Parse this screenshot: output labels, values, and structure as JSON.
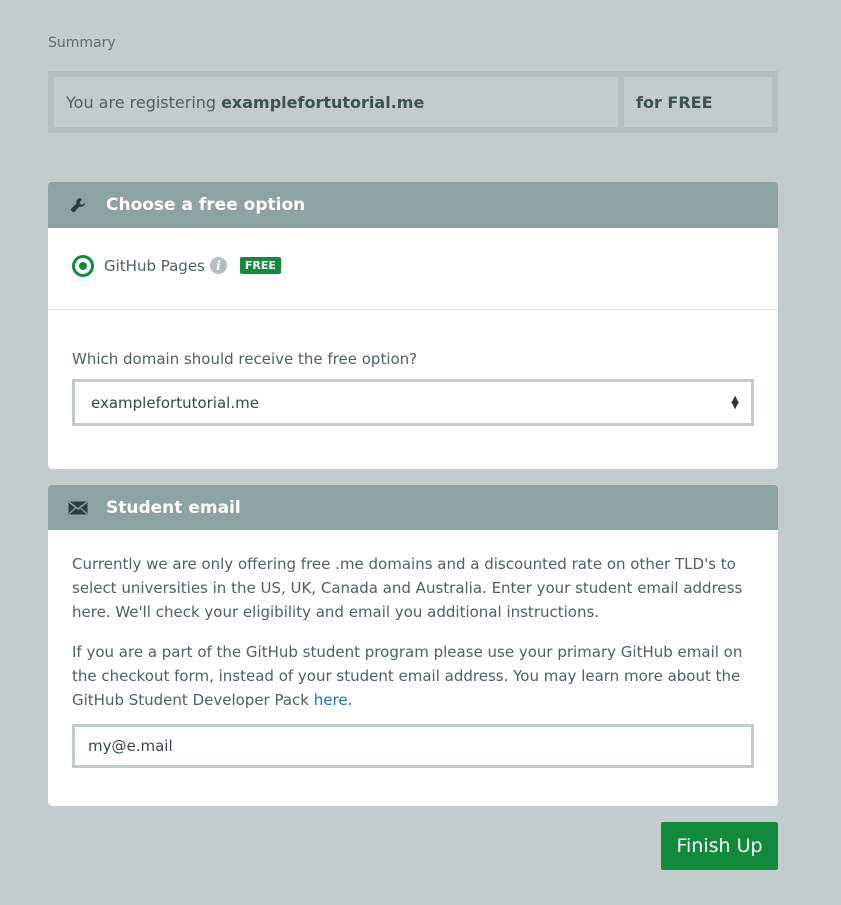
{
  "summary": {
    "label": "Summary",
    "registering_prefix": "You are registering",
    "domain": "examplefortutorial.me",
    "price": "for FREE"
  },
  "free_option": {
    "title": "Choose a free option",
    "icon": "wrench-icon",
    "option_label": "GitHub Pages",
    "option_selected": true,
    "badge": "FREE",
    "question": "Which domain should receive the free option?",
    "selected_domain": "examplefortutorial.me"
  },
  "student_email": {
    "title": "Student email",
    "icon": "envelope-icon",
    "paragraph1": "Currently we are only offering free .me domains and a discounted rate on other TLD's to select universities in the US, UK, Canada and Australia. Enter your student email address here. We'll check your eligibility and email you additional instructions.",
    "paragraph2_prefix": "If you are a part of the GitHub student program please use your primary GitHub email on the checkout form, instead of your student email address. You may learn more about the GitHub Student Developer Pack",
    "paragraph2_link": "here",
    "paragraph2_suffix": ".",
    "email_value": "my@e.mail"
  },
  "finish_button": "Finish Up",
  "colors": {
    "accent_green": "#118a3c",
    "header_gray": "#8da2a3",
    "background": "#c2cccd",
    "link_blue": "#1a6fbf"
  }
}
